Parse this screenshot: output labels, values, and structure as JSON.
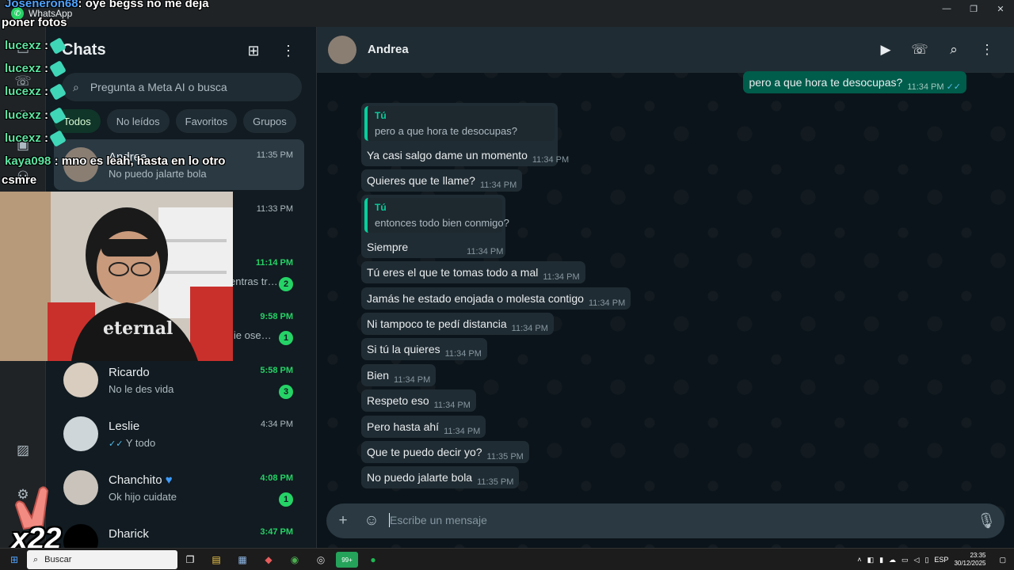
{
  "window": {
    "app_title": "WhatsApp",
    "controls": [
      "—",
      "❐",
      "✕"
    ]
  },
  "rail": {
    "icons": [
      "chat-icon",
      "phone-icon",
      "status-icon",
      "channels-icon",
      "communities-icon",
      "media-icon",
      "settings-icon"
    ]
  },
  "chat_list": {
    "title": "Chats",
    "search_placeholder": "Pregunta a Meta AI o busca",
    "filters": [
      "Todos",
      "No leídos",
      "Favoritos",
      "Grupos"
    ],
    "items": [
      {
        "name": "Andrea",
        "preview": "No puedo jalarte bola",
        "time": "11:35 PM",
        "unread": "",
        "selected": true
      },
      {
        "name": "",
        "preview": "",
        "time": "11:33 PM",
        "unread": ""
      },
      {
        "name": "",
        "preview": "entras tr…",
        "time": "11:14 PM",
        "unread": "2"
      },
      {
        "name": "",
        "preview": "lie ose…",
        "time": "9:58 PM",
        "unread": "1"
      },
      {
        "name": "Ricardo",
        "preview": "No le des vida",
        "time": "5:58 PM",
        "unread": "3"
      },
      {
        "name": "Leslie",
        "preview": "Y todo",
        "time": "4:34 PM",
        "unread": ""
      },
      {
        "name": "Chanchito",
        "preview": "Ok hijo cuidate",
        "time": "4:08 PM",
        "unread": "1"
      },
      {
        "name": "Dharick",
        "preview": "",
        "time": "3:47 PM",
        "unread": ""
      }
    ]
  },
  "conversation": {
    "contact": "Andrea",
    "messages": [
      {
        "text": "pero a que hora te desocupas?",
        "time": "11:34 PM",
        "dir": "out"
      },
      {
        "quote_author": "Tú",
        "quote_text": "pero a que hora te desocupas?",
        "text": "Ya casi salgo dame un momento",
        "time": "11:34 PM",
        "dir": "in"
      },
      {
        "text": "Quieres que te llame?",
        "time": "11:34 PM",
        "dir": "in"
      },
      {
        "quote_author": "Tú",
        "quote_text": "entonces todo bien conmigo?",
        "text": "Siempre",
        "time": "11:34 PM",
        "dir": "in"
      },
      {
        "text": "Tú eres el que te tomas todo a mal",
        "time": "11:34 PM",
        "dir": "in"
      },
      {
        "text": "Jamás he estado enojada o molesta contigo",
        "time": "11:34 PM",
        "dir": "in"
      },
      {
        "text": "Ni tampoco te pedí distancia",
        "time": "11:34 PM",
        "dir": "in"
      },
      {
        "text": "Si tú la quieres",
        "time": "11:34 PM",
        "dir": "in"
      },
      {
        "text": "Bien",
        "time": "11:34 PM",
        "dir": "in"
      },
      {
        "text": "Respeto eso",
        "time": "11:34 PM",
        "dir": "in"
      },
      {
        "text": "Pero hasta ahí",
        "time": "11:34 PM",
        "dir": "in"
      },
      {
        "text": "Que te puedo decir yo?",
        "time": "11:35 PM",
        "dir": "in"
      },
      {
        "text": "No puedo jalarte bola",
        "time": "11:35 PM",
        "dir": "in"
      }
    ],
    "composer_placeholder": "Escribe un mensaje"
  },
  "stream_overlay": {
    "chat": [
      {
        "user": "Joseneron68",
        "text": ": oye begss no me deja"
      },
      {
        "user": "",
        "text": "poner fotos"
      },
      {
        "user": "lucexz",
        "text": ":"
      },
      {
        "user": "lucexz",
        "text": ":"
      },
      {
        "user": "lucexz",
        "text": ":"
      },
      {
        "user": "lucexz",
        "text": ":"
      },
      {
        "user": "lucexz",
        "text": ":"
      },
      {
        "user": "kaya098",
        "text": ": mno es leah, hasta en lo otro"
      },
      {
        "user": "",
        "text": "csmre"
      }
    ],
    "combo": "x22"
  },
  "taskbar": {
    "search_label": "Buscar",
    "whatsapp_badge": "99+",
    "language": "ESP",
    "time": "23:35",
    "date": "30/12/2025"
  }
}
